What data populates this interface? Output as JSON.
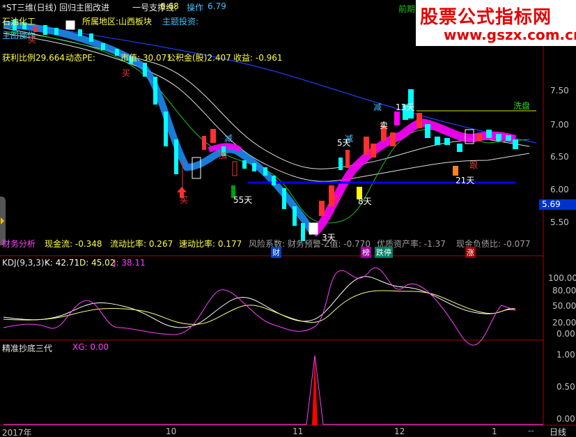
{
  "header": {
    "title": "*ST三维(日线) 回归主图改进",
    "support_label": "一号支撑线:",
    "support_value": "6.68",
    "op_label": "操作",
    "op_value": "6.79",
    "prev_label": "前期高"
  },
  "info": {
    "industry": "石油化工",
    "region": "所属地区:山西板块",
    "theme": "主题投资:",
    "ops": "主图操作",
    "profit_ratio": "获利比例29.664",
    "dyn_pe": "动态PE:",
    "market_cap": "市值: 30.071",
    "fund": "公积金(股)2.407",
    "eps": "收益: -0.961",
    "finance": "财务分析",
    "cash_flow": "现金流:  -0.348",
    "liquidity": "流动比率: 0.267",
    "quick": "速动比率: 0.177",
    "risk": "风险系数: 财务预警-Z值: -0.770",
    "quality": "优质资产率: -1.37",
    "cash_debt": "现金负债比: -0.077"
  },
  "annotations": {
    "xipan": "洗盘",
    "d55": "55天",
    "d21": "21天",
    "d8": "8天",
    "d5": "5天",
    "d13": "13天",
    "d3": "3天",
    "jian1": "减",
    "jian2": "减",
    "jian3": "减",
    "jia1": "加",
    "jia2": "加",
    "mai1": "买",
    "mai2": "买",
    "mai3": "买",
    "mai4": "卖",
    "gen": "跟",
    "cai": "财",
    "bang": "榜",
    "dieting": "跌停",
    "zhang": "涨",
    "price_box": "5.69"
  },
  "price_axis": [
    "7.50",
    "7.00",
    "6.50",
    "6.00",
    "5.50"
  ],
  "kdj": {
    "title": "KDJ(9,3,3)",
    "k": "K: 42.71",
    "d": "D: 45.02",
    "j": "J: 38.11",
    "axis": [
      "100.00",
      "80.00",
      "50.00",
      "20.00",
      "0.00"
    ]
  },
  "xg": {
    "title": "精准抄底三代",
    "value": "XG: 0.00",
    "axis": [
      "1.00",
      "0.50",
      "0.00"
    ]
  },
  "time_axis": [
    "2017年",
    "10",
    "11",
    "12",
    "1"
  ],
  "bottom": {
    "dashes": "--",
    "period": "日线"
  },
  "watermark": {
    "title": "股票公式指标网",
    "url": "www.gszx.com.cn"
  },
  "colors": {
    "up": "#ff3030",
    "down": "#00ffff",
    "ribbon_up": "#ff00ff",
    "ribbon_down": "#1e90ff",
    "support_line": "#0000ff",
    "ma_long": "#2040ff",
    "k_line": "#ffffff",
    "d_line": "#ffff80",
    "j_line": "#ff40ff"
  }
}
